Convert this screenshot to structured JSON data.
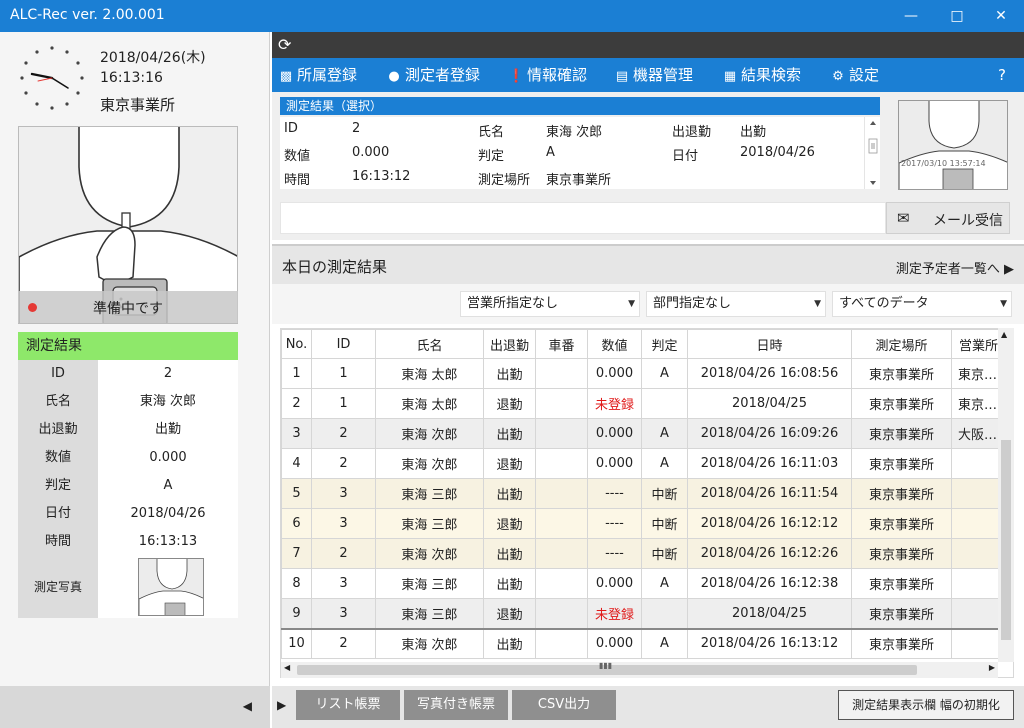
{
  "window": {
    "title": "ALC-Rec  ver. 2.00.001",
    "minimize_icon": "minimize-icon",
    "maximize_icon": "maximize-icon",
    "close_icon": "close-icon"
  },
  "left_panel": {
    "date": "2018/04/26(木)",
    "time": "16:13:16",
    "office": "東京事業所",
    "status_text": "準備中です",
    "status_color": "#e53935",
    "result": {
      "header": "測定結果",
      "header_color": "#8ee86a",
      "rows": [
        {
          "label": "ID",
          "value": "2"
        },
        {
          "label": "氏名",
          "value": "東海  次郎"
        },
        {
          "label": "出退勤",
          "value": "出勤"
        },
        {
          "label": "数値",
          "value": "0.000"
        },
        {
          "label": "判定",
          "value": "A"
        },
        {
          "label": "日付",
          "value": "2018/04/26"
        },
        {
          "label": "時間",
          "value": "16:13:13"
        }
      ],
      "photo_label": "測定写真"
    },
    "collapse_arrow": "◀"
  },
  "toolbar": {
    "refresh_icon": "refresh-icon"
  },
  "nav": {
    "items": [
      {
        "label": "所属登録",
        "icon": "building-icon"
      },
      {
        "label": "測定者登録",
        "icon": "person-icon"
      },
      {
        "label": "情報確認",
        "icon": "info-icon"
      },
      {
        "label": "機器管理",
        "icon": "device-icon"
      },
      {
        "label": "結果検索",
        "icon": "calendar-icon"
      },
      {
        "label": "設定",
        "icon": "gear-icon"
      }
    ],
    "help": "?"
  },
  "selected": {
    "header": "測定結果（選択）",
    "fields": [
      {
        "label": "ID",
        "value": "2"
      },
      {
        "label": "数値",
        "value": "0.000"
      },
      {
        "label": "時間",
        "value": "16:13:12"
      },
      {
        "label": "氏名",
        "value": "東海  次郎"
      },
      {
        "label": "判定",
        "value": "A"
      },
      {
        "label": "測定場所",
        "value": "東京事業所"
      },
      {
        "label": "出退勤",
        "value": "出勤"
      },
      {
        "label": "日付",
        "value": "2018/04/26"
      }
    ],
    "photo_stamp": "2017/03/10 13:57:14"
  },
  "message": {
    "input_value": "",
    "mail_button": "メール受信",
    "mail_icon": "mail-icon"
  },
  "today": {
    "title": "本日の測定結果",
    "schedule_link": "測定予定者一覧へ ▶"
  },
  "filters": {
    "office": "営業所指定なし",
    "department": "部門指定なし",
    "data": "すべてのデータ"
  },
  "table": {
    "columns": [
      "No.",
      "ID",
      "氏名",
      "出退勤",
      "車番",
      "数値",
      "判定",
      "日時",
      "測定場所",
      "営業所"
    ],
    "rows": [
      {
        "no": "1",
        "id": "1",
        "name": "東海  太郎",
        "shift": "出勤",
        "car": "",
        "value": "0.000",
        "judge": "A",
        "datetime": "2018/04/26 16:08:56",
        "place": "東京事業所",
        "office": "東京…"
      },
      {
        "no": "2",
        "id": "1",
        "name": "東海  太郎",
        "shift": "退勤",
        "car": "",
        "value": "未登録",
        "judge": "",
        "datetime": "2018/04/25",
        "place": "東京事業所",
        "office": "東京…"
      },
      {
        "no": "3",
        "id": "2",
        "name": "東海  次郎",
        "shift": "出勤",
        "car": "",
        "value": "0.000",
        "judge": "A",
        "datetime": "2018/04/26 16:09:26",
        "place": "東京事業所",
        "office": "大阪…"
      },
      {
        "no": "4",
        "id": "2",
        "name": "東海  次郎",
        "shift": "退勤",
        "car": "",
        "value": "0.000",
        "judge": "A",
        "datetime": "2018/04/26 16:11:03",
        "place": "東京事業所",
        "office": ""
      },
      {
        "no": "5",
        "id": "3",
        "name": "東海  三郎",
        "shift": "出勤",
        "car": "",
        "value": "----",
        "judge": "中断",
        "datetime": "2018/04/26 16:11:54",
        "place": "東京事業所",
        "office": ""
      },
      {
        "no": "6",
        "id": "3",
        "name": "東海  三郎",
        "shift": "退勤",
        "car": "",
        "value": "----",
        "judge": "中断",
        "datetime": "2018/04/26 16:12:12",
        "place": "東京事業所",
        "office": ""
      },
      {
        "no": "7",
        "id": "2",
        "name": "東海  次郎",
        "shift": "出勤",
        "car": "",
        "value": "----",
        "judge": "中断",
        "datetime": "2018/04/26 16:12:26",
        "place": "東京事業所",
        "office": ""
      },
      {
        "no": "8",
        "id": "3",
        "name": "東海  三郎",
        "shift": "出勤",
        "car": "",
        "value": "0.000",
        "judge": "A",
        "datetime": "2018/04/26 16:12:38",
        "place": "東京事業所",
        "office": ""
      },
      {
        "no": "9",
        "id": "3",
        "name": "東海  三郎",
        "shift": "退勤",
        "car": "",
        "value": "未登録",
        "judge": "",
        "datetime": "2018/04/25",
        "place": "東京事業所",
        "office": ""
      },
      {
        "no": "10",
        "id": "2",
        "name": "東海  次郎",
        "shift": "出勤",
        "car": "",
        "value": "0.000",
        "judge": "A",
        "datetime": "2018/04/26 16:13:12",
        "place": "東京事業所",
        "office": ""
      }
    ]
  },
  "bottom": {
    "play": "▶",
    "buttons": [
      "リスト帳票",
      "写真付き帳票",
      "CSV出力"
    ],
    "reset": "測定結果表示欄 幅の初期化"
  }
}
